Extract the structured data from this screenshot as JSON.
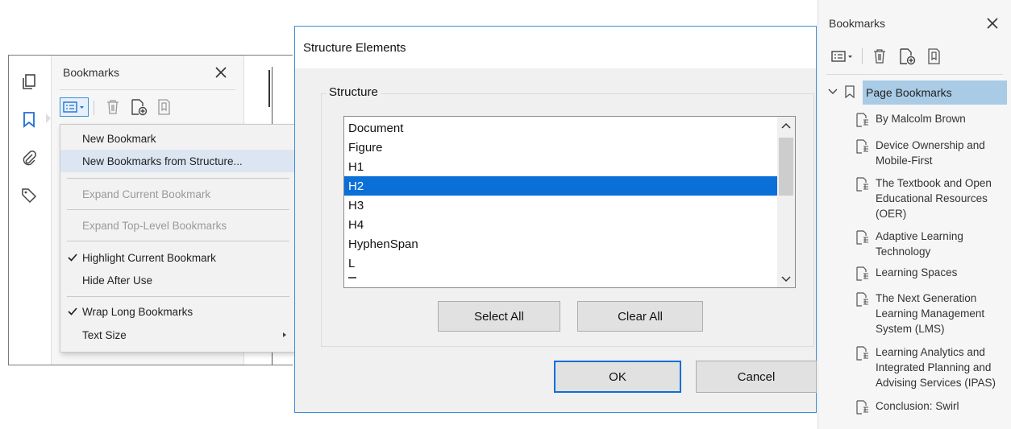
{
  "left_window": {
    "panel_title": "Bookmarks",
    "menu": {
      "items": [
        {
          "label": "New Bookmark",
          "state": "normal",
          "checked": false
        },
        {
          "label": "New Bookmarks from Structure...",
          "state": "hover",
          "checked": false
        },
        {
          "label": "Expand Current Bookmark",
          "state": "disabled",
          "checked": false
        },
        {
          "label": "Expand Top-Level Bookmarks",
          "state": "disabled",
          "checked": false
        },
        {
          "label": "Highlight Current Bookmark",
          "state": "normal",
          "checked": true
        },
        {
          "label": "Hide After Use",
          "state": "normal",
          "checked": false
        },
        {
          "label": "Wrap Long Bookmarks",
          "state": "normal",
          "checked": true
        },
        {
          "label": "Text Size",
          "state": "normal",
          "checked": false,
          "submenu": true
        }
      ]
    }
  },
  "dialog": {
    "title": "Structure Elements",
    "group_label": "Structure",
    "list_items": [
      "Document",
      "Figure",
      "H1",
      "H2",
      "H3",
      "H4",
      "HyphenSpan",
      "L"
    ],
    "selected_item": "H2",
    "select_all_label": "Select All",
    "clear_all_label": "Clear All",
    "ok_label": "OK",
    "cancel_label": "Cancel"
  },
  "right_panel": {
    "title": "Bookmarks",
    "root_label": "Page Bookmarks",
    "bookmarks": [
      "By Malcolm Brown",
      "Device Ownership and Mobile-First",
      "The Textbook and Open Educational Resources (OER)",
      "Adaptive Learning Technology",
      "Learning Spaces",
      "The Next Generation Learning Management System (LMS)",
      "Learning Analytics and Integrated Planning and Advising Services (IPAS)",
      "Conclusion: Swirl"
    ]
  },
  "colors": {
    "selection_blue": "#0a6fd6",
    "bookmark_highlight": "#a9cbe6",
    "menu_hover": "#dce6f2",
    "dialog_border": "#3c8bd6"
  }
}
